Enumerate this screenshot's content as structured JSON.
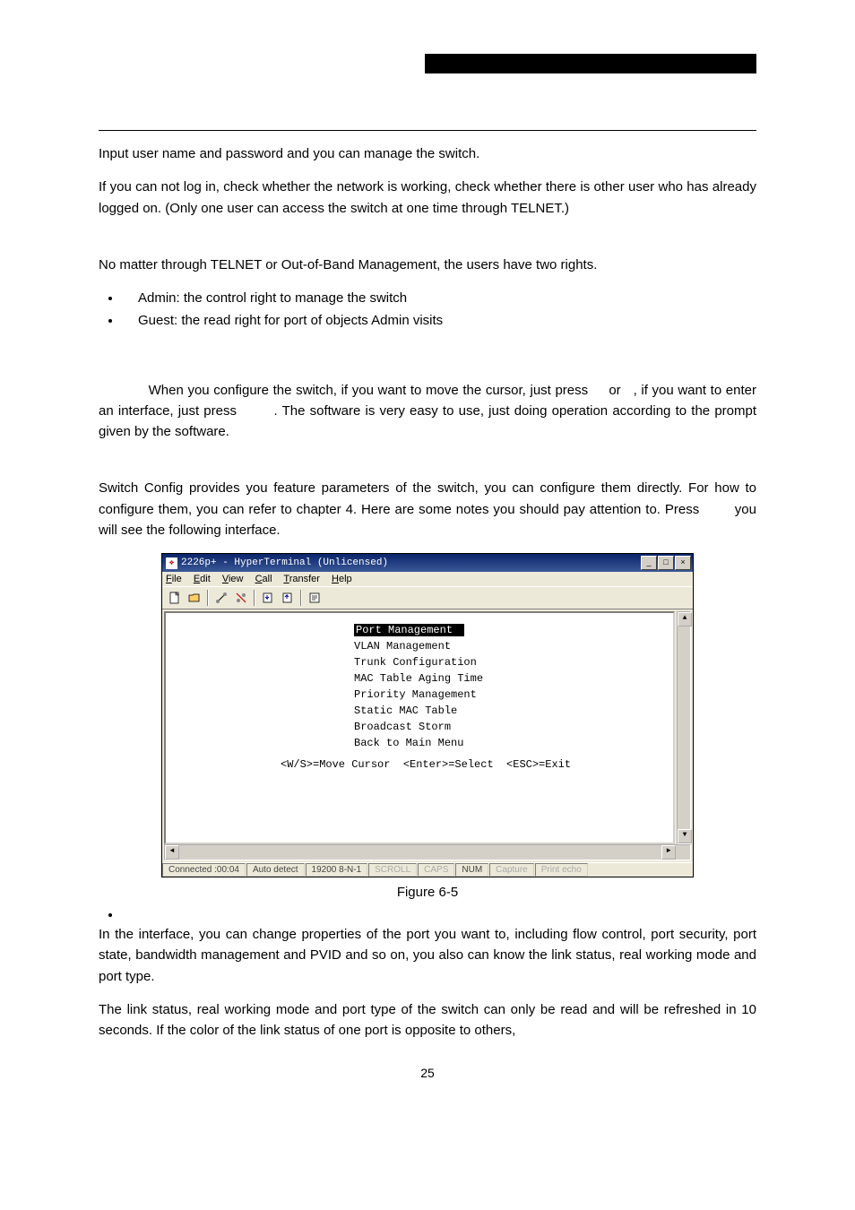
{
  "p1": "Input user name and password and you can manage the switch.",
  "p2": "If you can not log in, check whether the network is working, check whether there is other user who has already logged on. (Only one user can access the switch at one time through TELNET.)",
  "p3": "No matter through TELNET or Out-of-Band Management, the users have two rights.",
  "rights": [
    "Admin:   the control right to manage the switch",
    "Guest:   the read right for port of objects Admin visits"
  ],
  "p4": "            When you configure the switch, if you want to move the cursor, just press     or   , if you want to enter an interface, just press        . The software is very easy to use, just doing operation according to the prompt given by the software.",
  "p5": "Switch Config provides you feature parameters of the switch, you can configure them directly. For how to configure them, you can refer to chapter 4. Here are some notes you should pay attention to. Press        you will see the following interface.",
  "win": {
    "title": "2226p+ - HyperTerminal (Unlicensed)",
    "status": [
      "Connected :00:04",
      "Auto detect",
      "19200 8-N-1",
      "SCROLL",
      "CAPS",
      "NUM",
      "Capture",
      "Print echo"
    ]
  },
  "term": {
    "items": [
      "Port Management",
      "VLAN Management",
      "Trunk Configuration",
      "MAC Table Aging Time",
      "Priority Management",
      "Static MAC Table",
      "Broadcast Storm",
      "Back to Main Menu"
    ],
    "hint": "<W/S>=Move Cursor  <Enter>=Select  <ESC>=Exit"
  },
  "figcap": "Figure 6-5",
  "p6": "In the interface, you can change properties of the port you want to, including flow control, port security, port state, bandwidth management and PVID and so on, you also can know the link status, real working mode and port type.",
  "p7": "The link status, real working mode and port type of the switch can only be read and will be refreshed in 10 seconds. If the color of the link status of one port is opposite to others,",
  "pagenum": "25"
}
